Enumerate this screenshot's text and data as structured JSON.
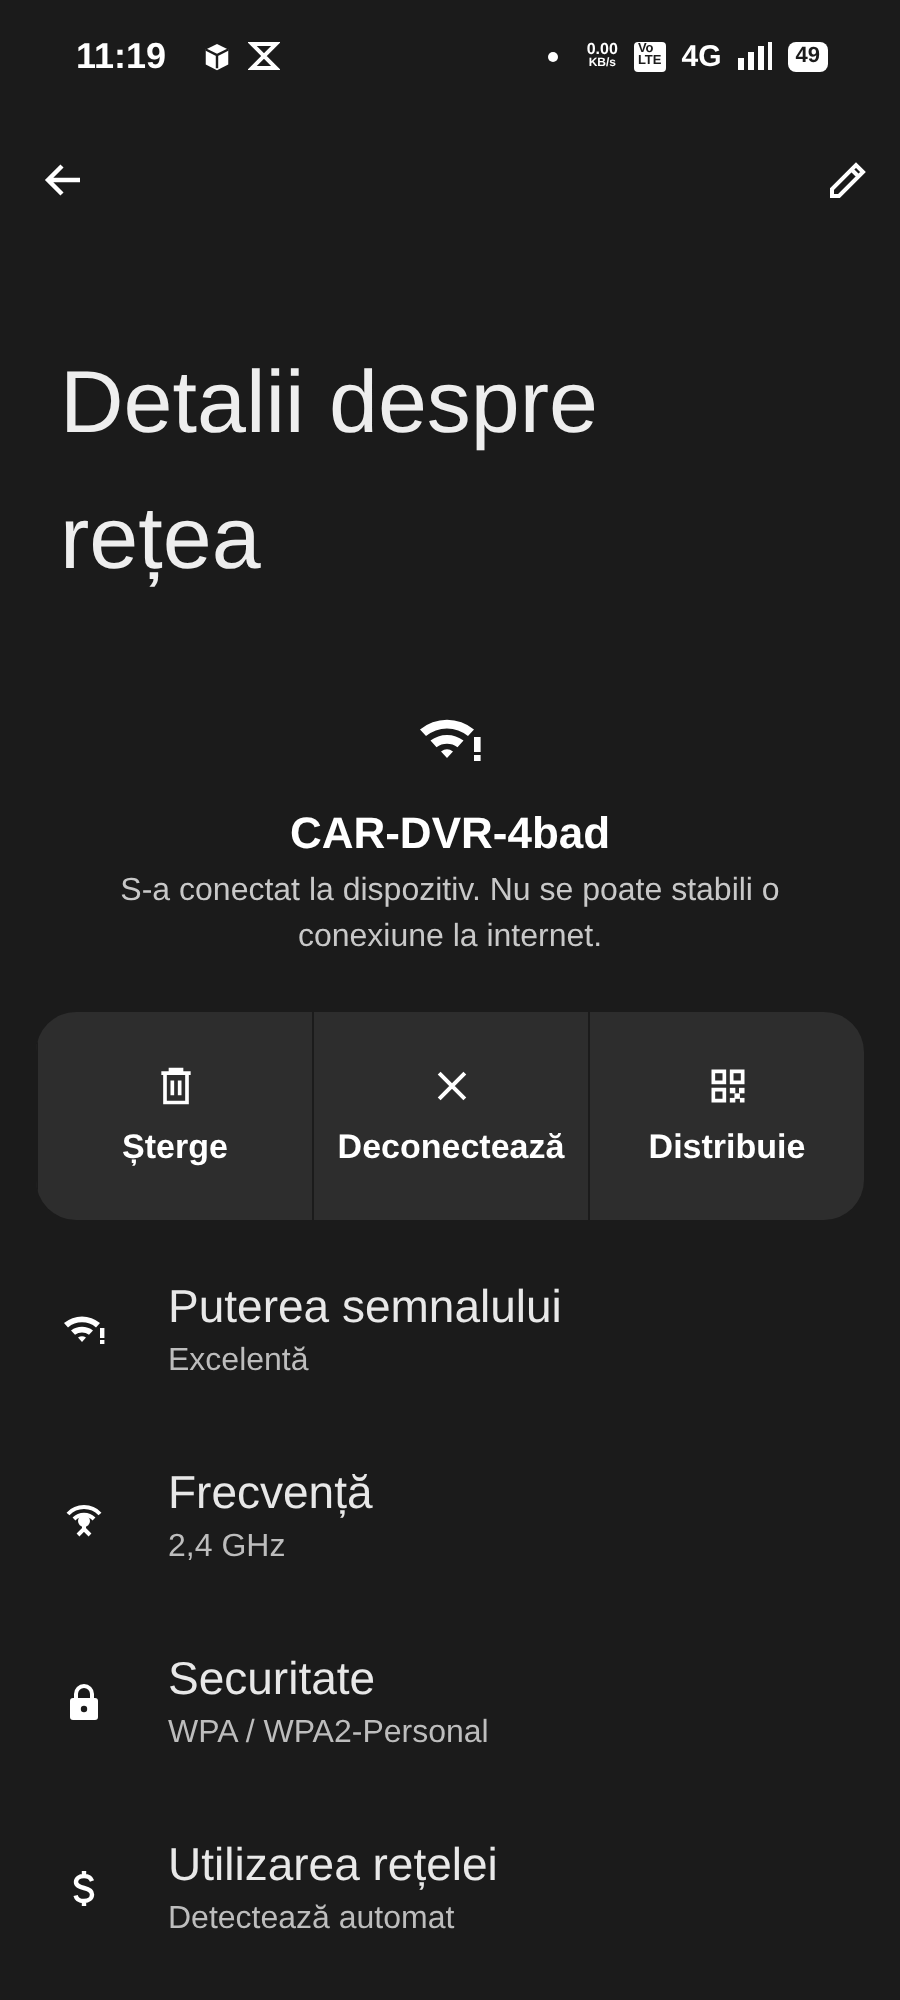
{
  "status_bar": {
    "time": "11:19",
    "speed_value": "0.00",
    "speed_unit": "KB/s",
    "volte_top": "Vo",
    "volte_bottom": "LTE",
    "network": "4G",
    "battery": "49"
  },
  "title": "Detalii despre rețea",
  "network": {
    "name": "CAR-DVR-4bad",
    "status": "S-a conectat la dispozitiv. Nu se poate stabili o conexiune la internet."
  },
  "actions": [
    {
      "kind": "delete",
      "label": "Șterge"
    },
    {
      "kind": "disconnect",
      "label": "Deconectează"
    },
    {
      "kind": "share",
      "label": "Distribuie"
    }
  ],
  "details": [
    {
      "kind": "signal",
      "title": "Puterea semnalului",
      "value": "Excelentă"
    },
    {
      "kind": "frequency",
      "title": "Frecvență",
      "value": "2,4 GHz"
    },
    {
      "kind": "security",
      "title": "Securitate",
      "value": "WPA / WPA2-Personal"
    },
    {
      "kind": "usage",
      "title": "Utilizarea rețelei",
      "value": "Detectează automat"
    }
  ]
}
